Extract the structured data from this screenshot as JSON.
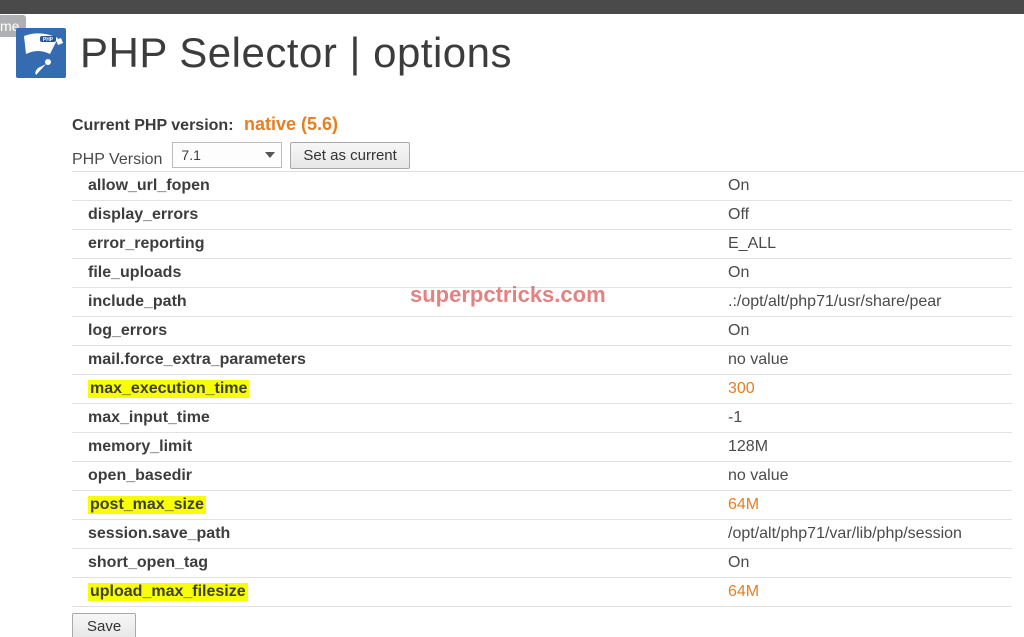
{
  "sidebar_tab": "me",
  "title": "PHP Selector | options",
  "current_label": "Current PHP version:",
  "current_value": "native (5.6)",
  "version_label": "PHP Version",
  "version_selected": "7.1",
  "set_current_btn": "Set as current",
  "save_btn": "Save",
  "watermark": "superpctricks.com",
  "options": [
    {
      "key": "allow_url_fopen",
      "value": "On",
      "highlight": false,
      "orange": false
    },
    {
      "key": "display_errors",
      "value": "Off",
      "highlight": false,
      "orange": false
    },
    {
      "key": "error_reporting",
      "value": "E_ALL",
      "highlight": false,
      "orange": false
    },
    {
      "key": "file_uploads",
      "value": "On",
      "highlight": false,
      "orange": false
    },
    {
      "key": "include_path",
      "value": ".:/opt/alt/php71/usr/share/pear",
      "highlight": false,
      "orange": false
    },
    {
      "key": "log_errors",
      "value": "On",
      "highlight": false,
      "orange": false
    },
    {
      "key": "mail.force_extra_parameters",
      "value": "no value",
      "highlight": false,
      "orange": false
    },
    {
      "key": "max_execution_time",
      "value": "300",
      "highlight": true,
      "orange": true
    },
    {
      "key": "max_input_time",
      "value": "-1",
      "highlight": false,
      "orange": false
    },
    {
      "key": "memory_limit",
      "value": "128M",
      "highlight": false,
      "orange": false
    },
    {
      "key": "open_basedir",
      "value": "no value",
      "highlight": false,
      "orange": false
    },
    {
      "key": "post_max_size",
      "value": "64M",
      "highlight": true,
      "orange": true
    },
    {
      "key": "session.save_path",
      "value": "/opt/alt/php71/var/lib/php/session",
      "highlight": false,
      "orange": false
    },
    {
      "key": "short_open_tag",
      "value": "On",
      "highlight": false,
      "orange": false
    },
    {
      "key": "upload_max_filesize",
      "value": "64M",
      "highlight": true,
      "orange": true
    }
  ]
}
